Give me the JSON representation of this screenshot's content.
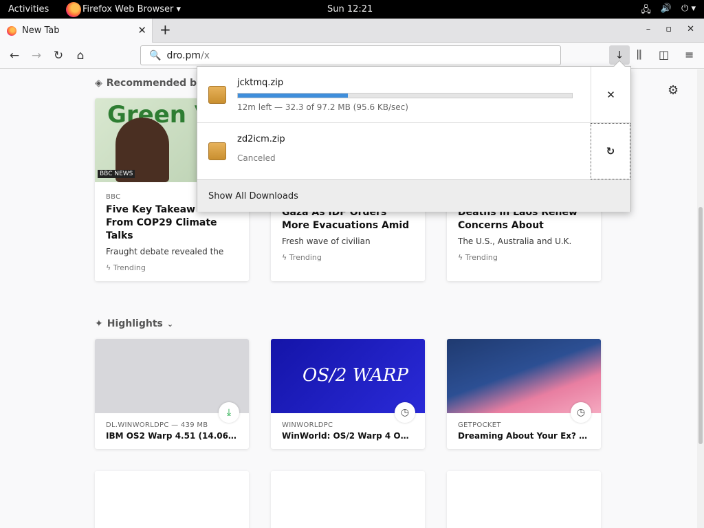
{
  "system": {
    "activities": "Activities",
    "app_name": "Firefox Web Browser ▾",
    "clock": "Sun 12:21"
  },
  "browser": {
    "tab_label": "New Tab",
    "url_host": "dro.pm",
    "url_path": "/x"
  },
  "downloads": {
    "items": [
      {
        "name": "jcktmq.zip",
        "progress": 0.33,
        "status": "12m left — 32.3 of 97.2 MB (95.6 KB/sec)",
        "action": "cancel"
      },
      {
        "name": "zd2icm.zip",
        "status": "Canceled",
        "action": "retry"
      }
    ],
    "show_all": "Show All Downloads"
  },
  "recommended": {
    "heading": "Recommended by",
    "cards": [
      {
        "source": "BBC",
        "title": "Five Key Takeaways From COP29 Climate Talks",
        "title_display": [
          "Five Key Takeaw",
          "From COP29 Climate",
          "Talks"
        ],
        "excerpt": "Fraught debate revealed the",
        "trend": "Trending"
      },
      {
        "source": "",
        "title_display": [
          "",
          "Gaza As IDF Orders",
          "More Evacuations Amid"
        ],
        "excerpt": "Fresh wave of civilian",
        "trend": "Trending"
      },
      {
        "source": "",
        "title_display": [
          "",
          "Deaths in Laos Renew",
          "Concerns About"
        ],
        "excerpt": "The U.S., Australia and U.K.",
        "trend": "Trending"
      }
    ],
    "thumb_text": "Green V",
    "thumb_logo": "BBC NEWS"
  },
  "highlights": {
    "heading": "Highlights",
    "cards": [
      {
        "source": "DL.WINWORLDPC — 439 MB",
        "title": "IBM OS2 Warp 4.51 (14.06…",
        "badge": "download-icon"
      },
      {
        "source": "WINWORLDPC",
        "title": "WinWorld: OS/2 Warp 4 O…",
        "badge": "clock-icon"
      },
      {
        "source": "GETPOCKET",
        "title": "Dreaming About Your Ex? …",
        "badge": "clock-icon"
      }
    ],
    "os2_text": "OS/2 WARP"
  }
}
